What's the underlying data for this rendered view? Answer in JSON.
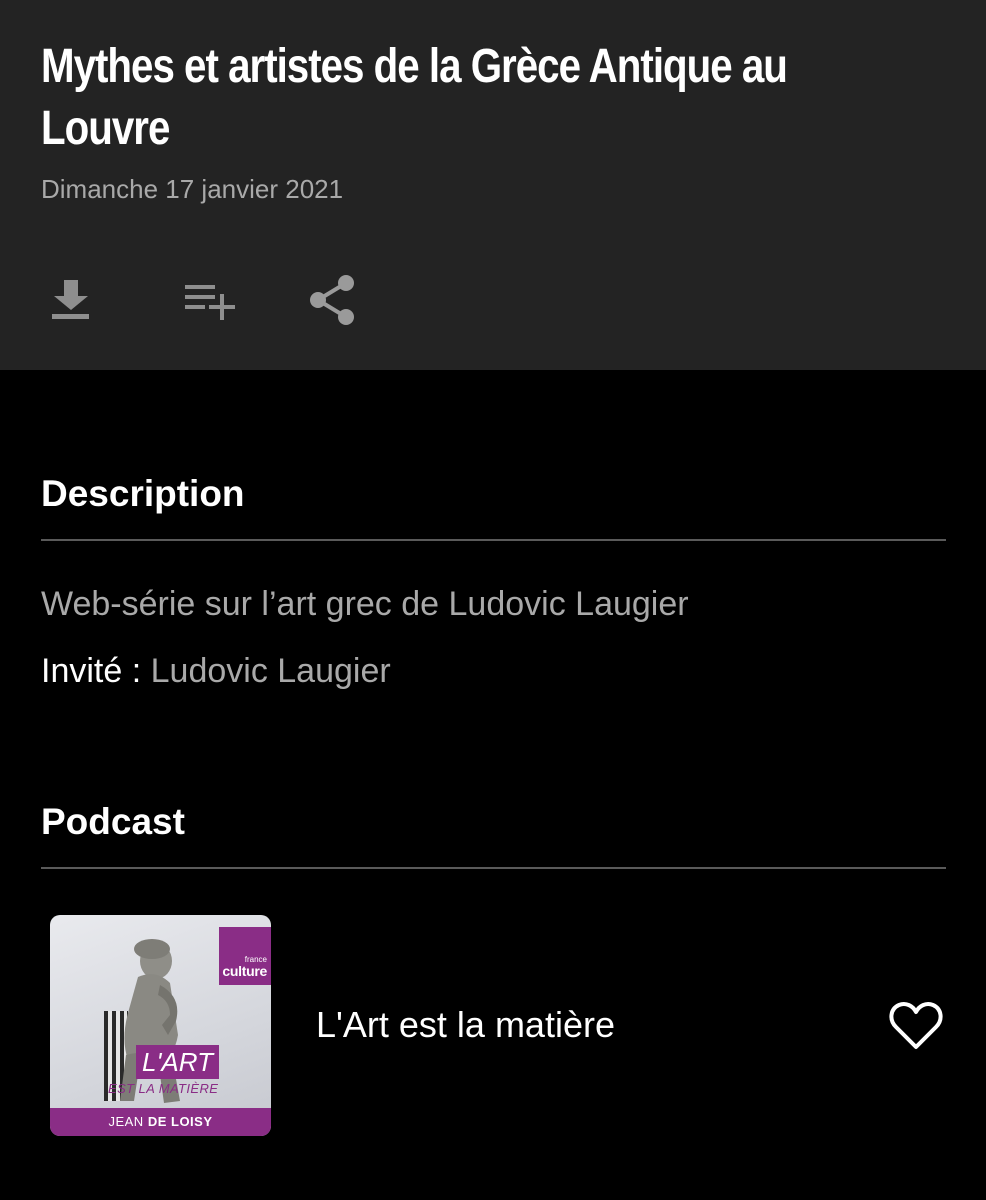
{
  "episode": {
    "title": "Mythes et artistes de la Grèce Antique au Louvre",
    "date": "Dimanche 17 janvier 2021"
  },
  "actions": [
    {
      "name": "download",
      "icon": "download-icon"
    },
    {
      "name": "add-to-playlist",
      "icon": "playlist-add-icon"
    },
    {
      "name": "share",
      "icon": "share-icon"
    }
  ],
  "description": {
    "heading": "Description",
    "text": "Web-série sur l’art grec de Ludovic Laugier",
    "guest_label": "Invité :",
    "guest_name": "Ludovic Laugier"
  },
  "podcast": {
    "heading": "Podcast",
    "name": "L'Art est la matière",
    "cover": {
      "brand_small": "france",
      "brand_big": "culture",
      "title_line1": "L'ART",
      "title_line2": "EST LA MATIÈRE",
      "author_first": "JEAN",
      "author_last": "DE LOISY"
    },
    "favorite_icon": "heart-outline-icon"
  },
  "colors": {
    "header_bg": "#232323",
    "page_bg": "#000000",
    "muted_text": "#a9a9a9",
    "brand_purple": "#8a2d86"
  }
}
